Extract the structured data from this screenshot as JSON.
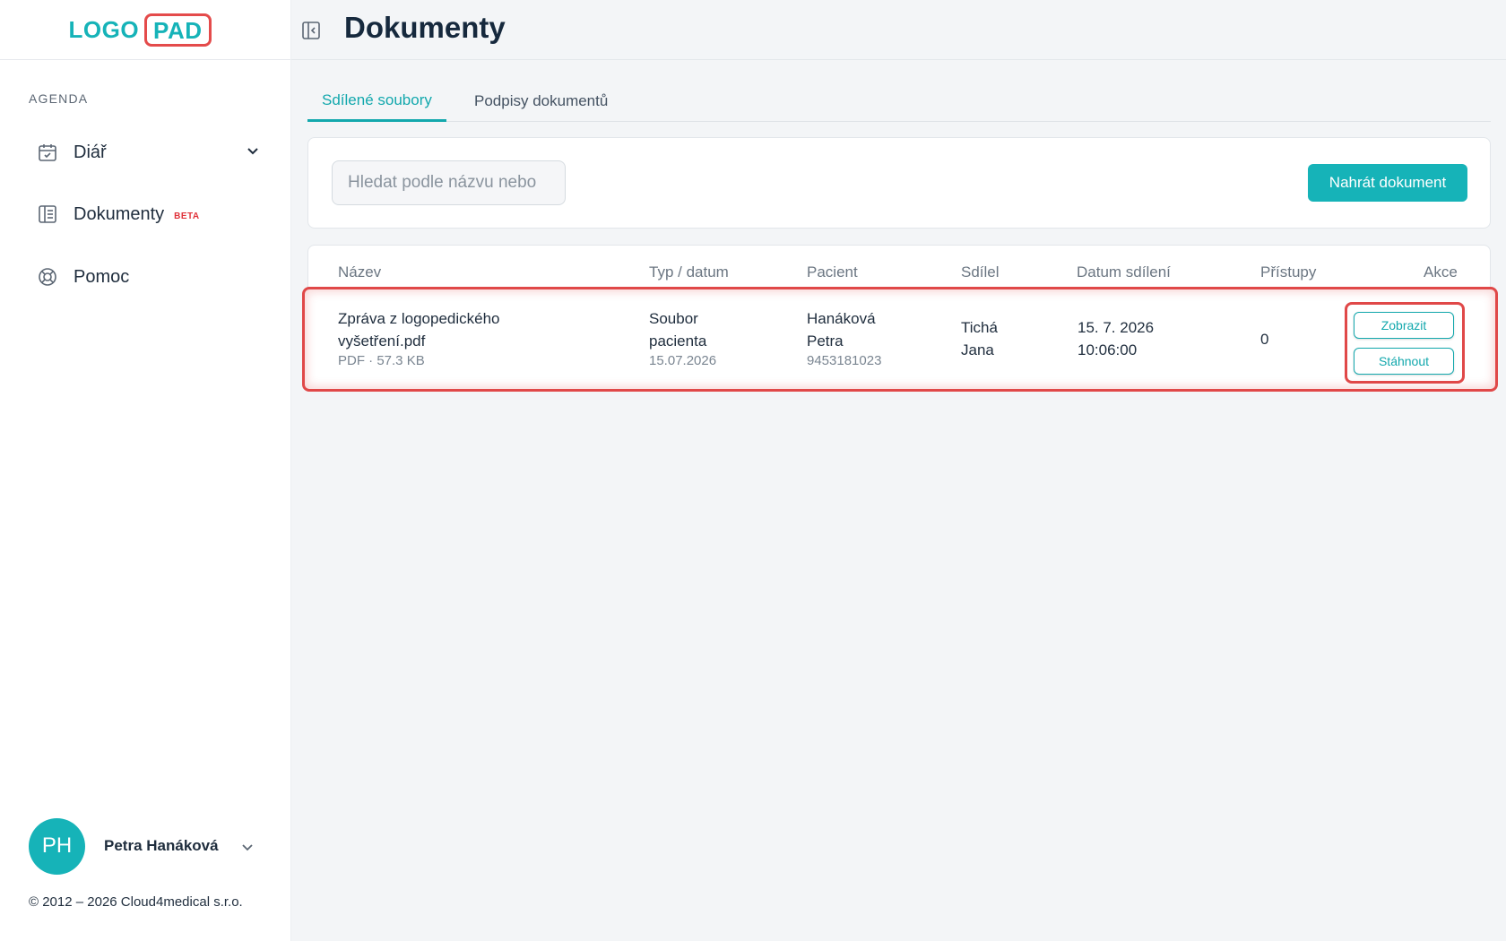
{
  "sidebar": {
    "logo": {
      "part_a": "LOGO",
      "part_b": "PAD"
    },
    "section_label": "AGENDA",
    "items": [
      {
        "label": "Diář",
        "icon": "calendar-check-icon"
      },
      {
        "label": "Dokumenty",
        "icon": "document-list-icon",
        "badge": "BETA"
      },
      {
        "label": "Pomoc",
        "icon": "lifebuoy-icon"
      }
    ],
    "user": {
      "initials": "PH",
      "name": "Petra Hanáková"
    },
    "copyright": "© 2012 – 2026 Cloud4medical s.r.o."
  },
  "header": {
    "title": "Dokumenty"
  },
  "tabs": [
    {
      "label": "Sdílené soubory",
      "active": true
    },
    {
      "label": "Podpisy dokumentů",
      "active": false
    }
  ],
  "toolbar": {
    "search_placeholder": "Hledat podle názvu nebo",
    "upload_label": "Nahrát dokument"
  },
  "table": {
    "columns": [
      "Název",
      "Typ / datum",
      "Pacient",
      "Sdílel",
      "Datum sdílení",
      "Přístupy",
      "Akce"
    ],
    "rows": [
      {
        "name_line1": "Zpráva z logopedického",
        "name_line2": "vyšetření.pdf",
        "file_meta": "PDF · 57.3 KB",
        "type_line1": "Soubor",
        "type_line2": "pacienta",
        "type_date": "15.07.2026",
        "patient_line1": "Hanáková",
        "patient_line2": "Petra",
        "patient_id": "9453181023",
        "shared_by_line1": "Tichá",
        "shared_by_line2": "Jana",
        "shared_date": "15. 7. 2026",
        "shared_time": "10:06:00",
        "access_count": "0",
        "action_view": "Zobrazit",
        "action_download": "Stáhnout"
      }
    ]
  },
  "colors": {
    "accent": "#16b3b8",
    "highlight": "#e04848",
    "beta": "#e0323a"
  }
}
